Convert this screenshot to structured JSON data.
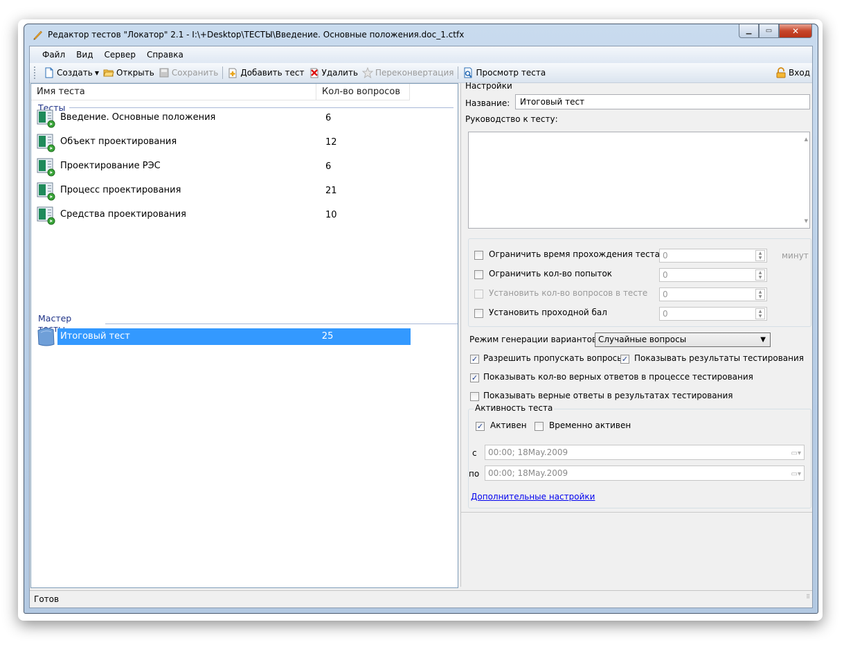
{
  "window": {
    "title": "Редактор тестов \"Локатор\" 2.1 - I:\\+Desktop\\ТЕСТЫ\\Введение. Основные положения.doc_1.ctfx"
  },
  "menu": [
    "Файл",
    "Вид",
    "Сервер",
    "Справка"
  ],
  "toolbar": {
    "create": "Создать",
    "open": "Открыть",
    "save": "Сохранить",
    "add_test": "Добавить тест",
    "delete": "Удалить",
    "reconvert": "Переконвертация",
    "preview": "Просмотр теста",
    "login": "Вход"
  },
  "list": {
    "col_name": "Имя теста",
    "col_count": "Кол-во вопросов",
    "group_tests": "Тесты",
    "tests": [
      {
        "name": "Введение. Основные положения",
        "count": "6"
      },
      {
        "name": "Объект проектирования",
        "count": "12"
      },
      {
        "name": "Проектирование РЭС",
        "count": "6"
      },
      {
        "name": "Процесс проектирования",
        "count": "21"
      },
      {
        "name": "Средства проектирования",
        "count": "10"
      }
    ],
    "group_master": "Мастер тесты",
    "master_tests": [
      {
        "name": "Итоговый тест",
        "count": "25",
        "selected": true
      }
    ]
  },
  "settings": {
    "section": "Настройки",
    "name_label": "Название:",
    "name_value": "Итоговый тест",
    "guide_label": "Руководство к тесту:",
    "limit_time": {
      "label": "Ограничить время прохождения теста",
      "checked": false,
      "value": "0",
      "unit": "минут"
    },
    "limit_attempts": {
      "label": "Ограничить кол-во попыток",
      "checked": false,
      "value": "0"
    },
    "set_questions": {
      "label": "Установить кол-во вопросов в тесте",
      "checked": false,
      "disabled": true,
      "value": "0"
    },
    "pass_score": {
      "label": "Установить проходной бал",
      "checked": false,
      "value": "0"
    },
    "mode_label": "Режим генерации вариантов",
    "mode_value": "Случайные вопросы",
    "allow_skip": {
      "label": "Разрешить пропускать вопросы",
      "checked": true
    },
    "show_results": {
      "label": "Показывать результаты тестирования",
      "checked": true
    },
    "show_correct_count": {
      "label": "Показывать кол-во верных ответов в процессе тестирования",
      "checked": true
    },
    "show_correct_answers": {
      "label": "Показывать верные ответы в результатах тестирования",
      "checked": false
    },
    "activity_group": "Активность теста",
    "active": {
      "label": "Активен",
      "checked": true
    },
    "temp_active": {
      "label": "Временно активен",
      "checked": false
    },
    "from_label": "с",
    "from_value": "00:00; 18May.2009",
    "to_label": "по",
    "to_value": "00:00; 18May.2009",
    "more_link": "Дополнительные настройки"
  },
  "status": "Готов",
  "colors": {
    "selection": "#3399ff",
    "group_header": "#1e3287"
  }
}
